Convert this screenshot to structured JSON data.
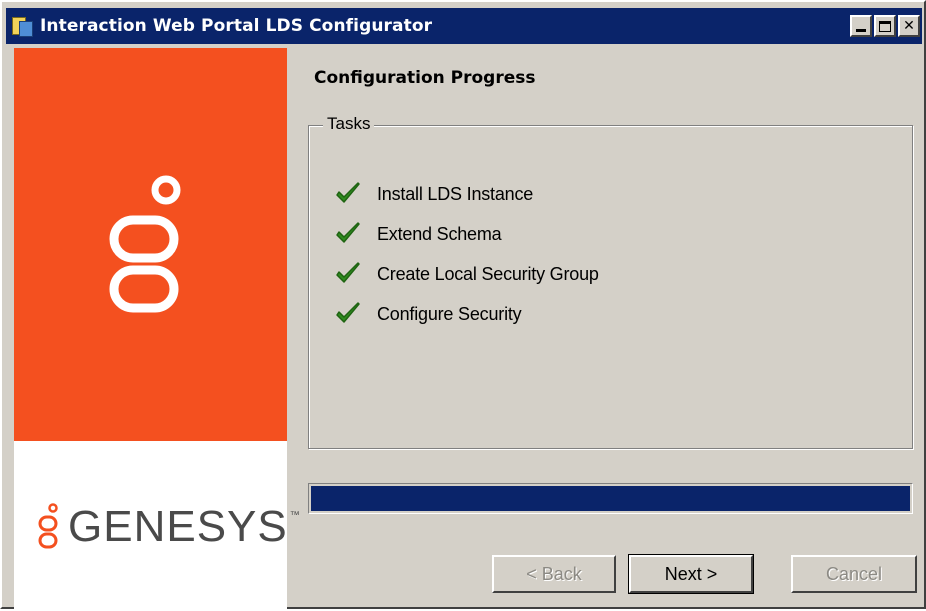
{
  "window": {
    "title": "Interaction Web Portal LDS Configurator",
    "icons": {
      "app": "app-icon",
      "minimize": "minimize-icon",
      "maximize": "maximize-icon",
      "close": "close-icon"
    },
    "close_glyph": "✕"
  },
  "branding": {
    "logo_icon": "genesys-logo-icon",
    "wordmark": "GENESYS",
    "trademark": "™",
    "orange_color": "#f4501f"
  },
  "page": {
    "title": "Configuration Progress"
  },
  "tasks": {
    "legend": "Tasks",
    "status_icon": "check-icon",
    "check_color": "#2e8b1e",
    "items": [
      {
        "label": "Install LDS Instance"
      },
      {
        "label": "Extend Schema"
      },
      {
        "label": "Create Local Security Group"
      },
      {
        "label": "Configure Security"
      }
    ]
  },
  "progress": {
    "percent": 100,
    "color": "#0a246a"
  },
  "buttons": {
    "back": "< Back",
    "next": "Next >",
    "cancel": "Cancel"
  }
}
